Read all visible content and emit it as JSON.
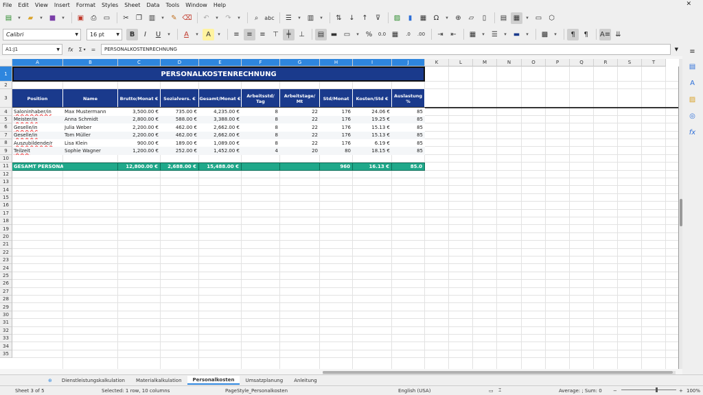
{
  "menu": [
    "File",
    "Edit",
    "View",
    "Insert",
    "Format",
    "Styles",
    "Sheet",
    "Data",
    "Tools",
    "Window",
    "Help"
  ],
  "toolbar": {
    "font_name": "Calibri",
    "font_size": "16 pt",
    "bold": "B",
    "italic": "I",
    "underline": "U",
    "font_color_glyph": "A",
    "highlight_glyph": "A",
    "percent": "%",
    "decimal": "0.0",
    "omega": "Ω"
  },
  "formula_bar": {
    "name_box": "A1:J1",
    "fx": "fx",
    "sum": "Σ",
    "equals": "=",
    "content": "PERSONALKOSTENRECHNUNG"
  },
  "columns": [
    "A",
    "B",
    "C",
    "D",
    "E",
    "F",
    "G",
    "H",
    "I",
    "J",
    "K",
    "L",
    "M",
    "N",
    "O",
    "P",
    "Q",
    "R",
    "S",
    "T"
  ],
  "rows": [
    "1",
    "2",
    "3",
    "4",
    "5",
    "6",
    "7",
    "8",
    "9",
    "10",
    "11",
    "12",
    "13",
    "14",
    "15",
    "16",
    "17",
    "18",
    "19",
    "20",
    "21",
    "22",
    "23",
    "24",
    "25",
    "26",
    "27",
    "28",
    "29",
    "30",
    "31",
    "32",
    "33",
    "34",
    "35"
  ],
  "sheet": {
    "title": "PERSONALKOSTENRECHNUNG",
    "headers": [
      "Position",
      "Name",
      "Brutto/Monat €",
      "Sozialvers. €",
      "Gesamt/Monat €",
      "Arbeitsstd/ Tag",
      "Arbeitstage/ Mt",
      "Std/Monat",
      "Kosten/Std €",
      "Auslastung %"
    ],
    "rows": [
      [
        "Saloninhaber/in",
        "Max Mustermann",
        "3,500.00 €",
        "735.00 €",
        "4,235.00 €",
        "8",
        "22",
        "176",
        "24.06 €",
        "85"
      ],
      [
        "Meister/in",
        "Anna Schmidt",
        "2,800.00 €",
        "588.00 €",
        "3,388.00 €",
        "8",
        "22",
        "176",
        "19.25 €",
        "85"
      ],
      [
        "Geselle/in",
        "Julia Weber",
        "2,200.00 €",
        "462.00 €",
        "2,662.00 €",
        "8",
        "22",
        "176",
        "15.13 €",
        "85"
      ],
      [
        "Geselle/in",
        "Tom Müller",
        "2,200.00 €",
        "462.00 €",
        "2,662.00 €",
        "8",
        "22",
        "176",
        "15.13 €",
        "85"
      ],
      [
        "Auszubildende/r",
        "Lisa Klein",
        "900.00 €",
        "189.00 €",
        "1,089.00 €",
        "8",
        "22",
        "176",
        "6.19 €",
        "85"
      ],
      [
        "Teilzeit",
        "Sophie Wagner",
        "1,200.00 €",
        "252.00 €",
        "1,452.00 €",
        "4",
        "20",
        "80",
        "18.15 €",
        "85"
      ]
    ],
    "total": [
      "GESAMT PERSONAL",
      "",
      "12,800.00 €",
      "2,688.00 €",
      "15,488.00 €",
      "",
      "",
      "960",
      "16.13 €",
      "85.0"
    ]
  },
  "tabs": [
    "Dienstleistungskalkulation",
    "Materialkalkulation",
    "Personalkosten",
    "Umsatzplanung",
    "Anleitung"
  ],
  "active_tab": "Personalkosten",
  "status": {
    "sheet": "Sheet 3 of 5",
    "selection": "Selected: 1 row, 10 columns",
    "pagestyle": "PageStyle_Personalkosten",
    "language": "English (USA)",
    "summary": "Average: ; Sum: 0",
    "zoom": "100%"
  },
  "colors": {
    "header_blue": "#1a3a8c",
    "total_green": "#1fa88a",
    "selection": "#2e86de"
  }
}
